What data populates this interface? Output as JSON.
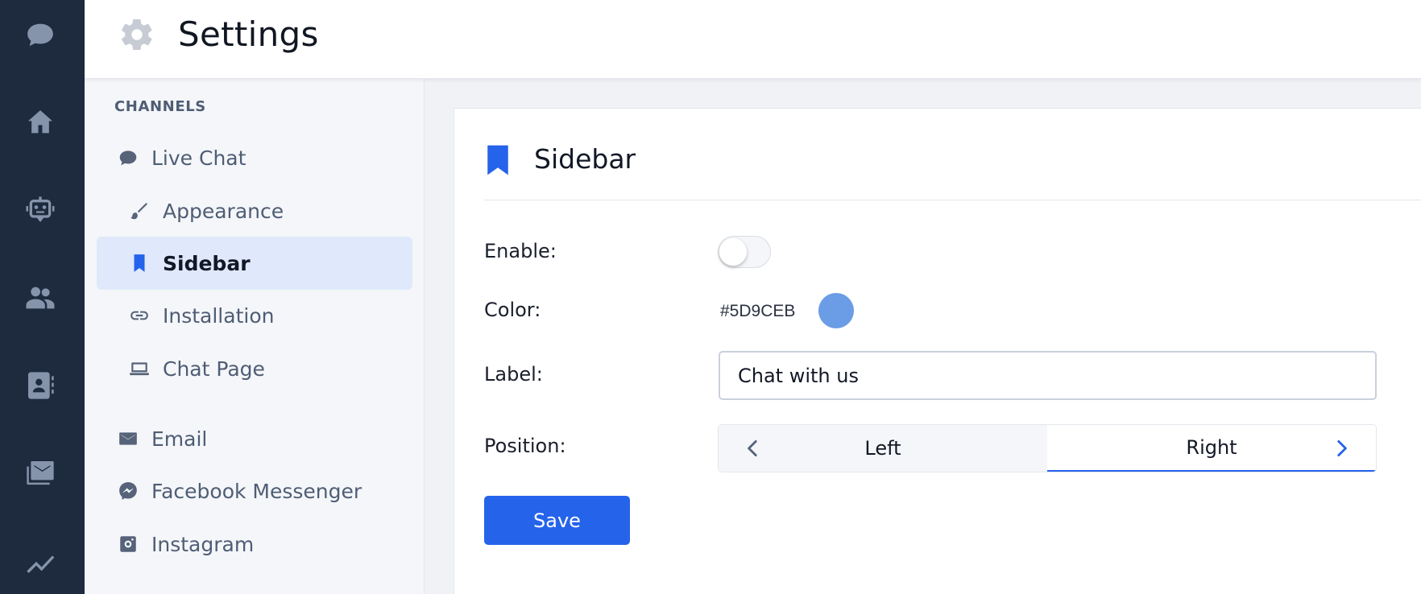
{
  "header": {
    "title": "Settings",
    "icon": "gear-icon"
  },
  "rail": {
    "items": [
      {
        "icon": "chat-bubble-icon"
      },
      {
        "icon": "home-icon"
      },
      {
        "icon": "bot-icon"
      },
      {
        "icon": "people-icon"
      },
      {
        "icon": "contacts-book-icon"
      },
      {
        "icon": "inbox-icon"
      },
      {
        "icon": "analytics-icon"
      }
    ]
  },
  "subnav": {
    "section": "CHANNELS",
    "items": [
      {
        "label": "Live Chat",
        "icon": "chat-bubble-icon"
      },
      {
        "label": "Appearance",
        "icon": "brush-icon"
      },
      {
        "label": "Sidebar",
        "icon": "bookmark-icon",
        "active": true
      },
      {
        "label": "Installation",
        "icon": "link-icon"
      },
      {
        "label": "Chat Page",
        "icon": "laptop-icon"
      },
      {
        "label": "Email",
        "icon": "mail-icon"
      },
      {
        "label": "Facebook Messenger",
        "icon": "messenger-icon"
      },
      {
        "label": "Instagram",
        "icon": "instagram-icon"
      }
    ]
  },
  "card": {
    "title": "Sidebar",
    "icon": "bookmark-icon",
    "enable": {
      "label": "Enable:",
      "value": false
    },
    "color": {
      "label": "Color:",
      "hex": "#5D9CEB",
      "swatch": "#6b9ce6"
    },
    "label_field": {
      "label": "Label:",
      "value": "Chat with us"
    },
    "position": {
      "label": "Position:",
      "options": [
        "Left",
        "Right"
      ],
      "selected": "Right"
    },
    "save_label": "Save"
  },
  "colors": {
    "accent": "#2563eb",
    "rail_bg": "#1e2a3e",
    "active_bg": "#dfe9fb"
  }
}
